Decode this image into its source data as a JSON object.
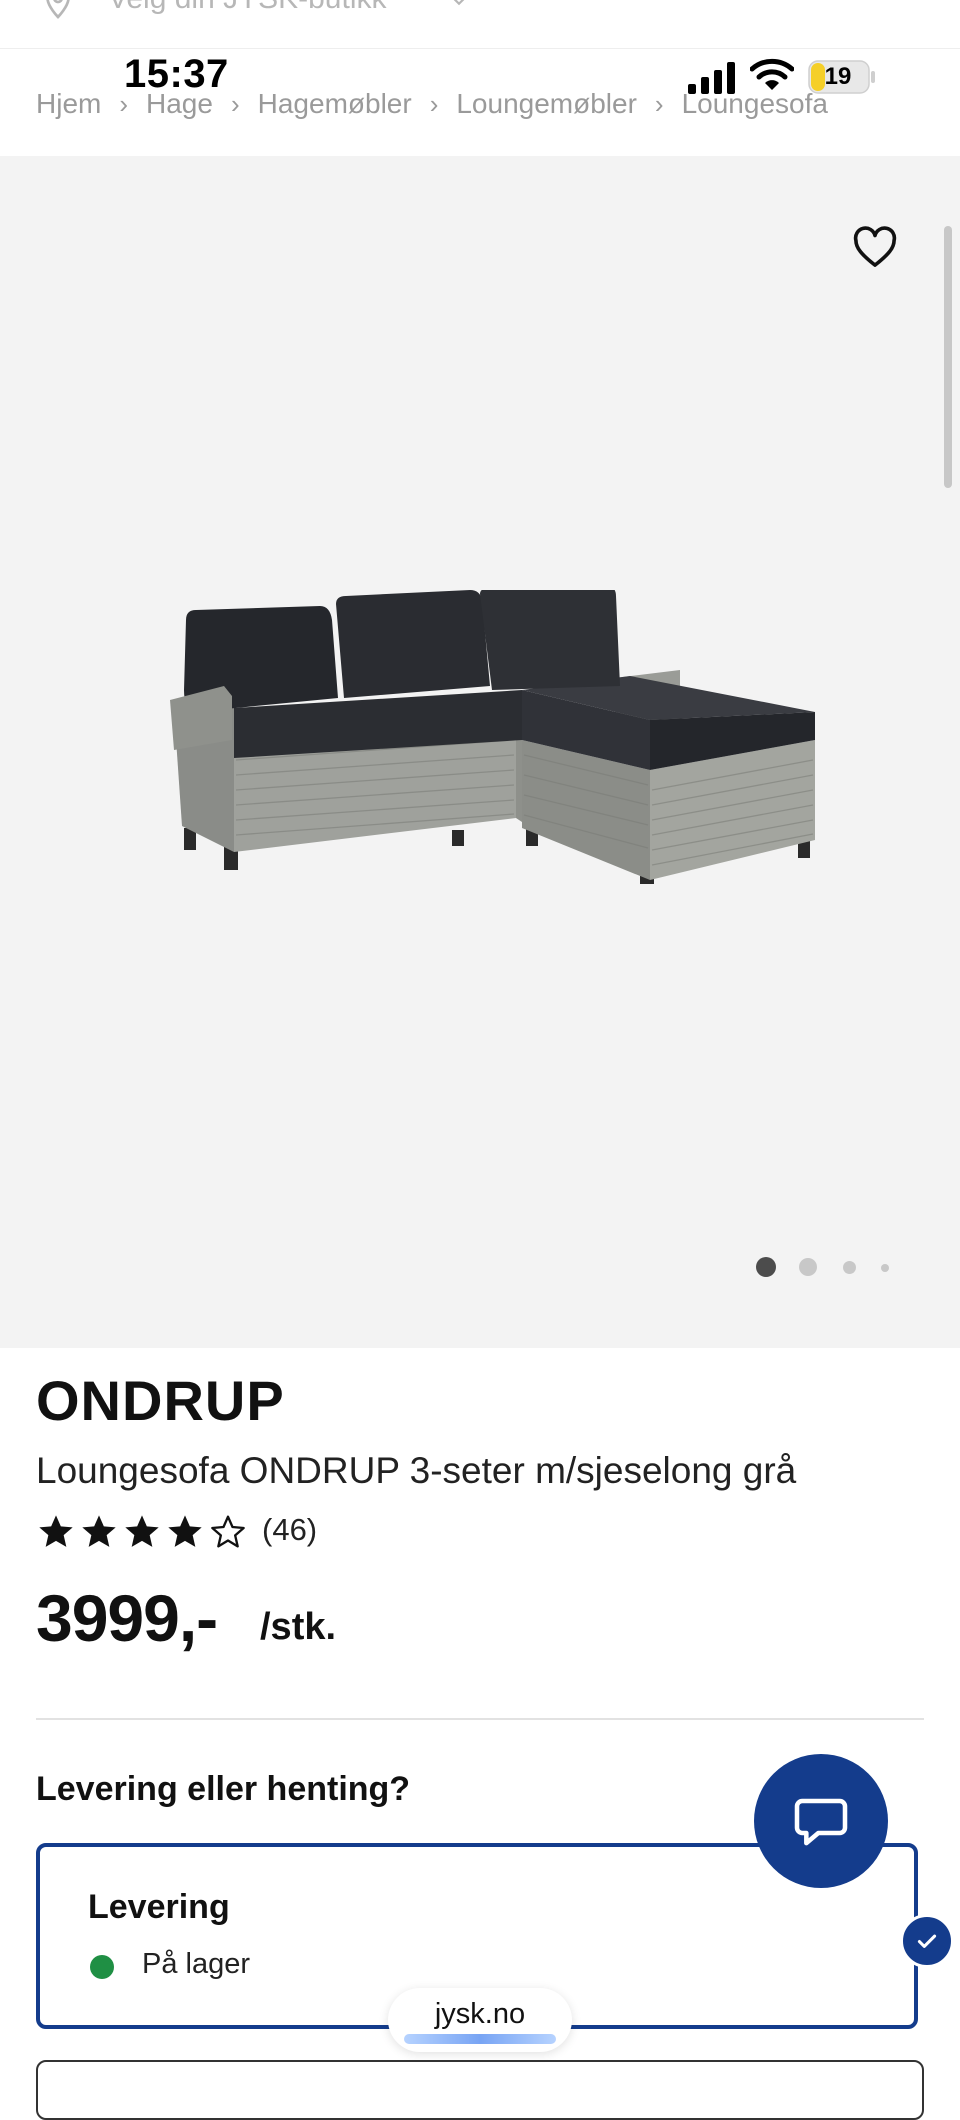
{
  "store_selector": {
    "label": "Velg din JYSK-butikk"
  },
  "status_bar": {
    "time": "15:37",
    "battery": "19"
  },
  "breadcrumb": {
    "items": [
      "Hjem",
      "Hage",
      "Hagemøbler",
      "Loungemøbler",
      "Loungesofa"
    ],
    "separator": "›"
  },
  "gallery": {
    "image_count": 4,
    "active_index": 0,
    "favorite_icon": "heart-icon"
  },
  "product": {
    "brand": "ONDRUP",
    "name": "Loungesofa ONDRUP 3-seter m/sjeselong grå",
    "rating": 4,
    "rating_max": 5,
    "reviews": "(46)",
    "price": "3999,-",
    "unit": "/stk."
  },
  "delivery": {
    "question": "Levering eller henting?",
    "option_title": "Levering",
    "stock_status": "På lager",
    "stock_color": "#1f8f44",
    "selected": true
  },
  "browser": {
    "url": "jysk.no"
  },
  "colors": {
    "brand_blue": "#143c8c",
    "gallery_bg": "#f3f3f3"
  }
}
